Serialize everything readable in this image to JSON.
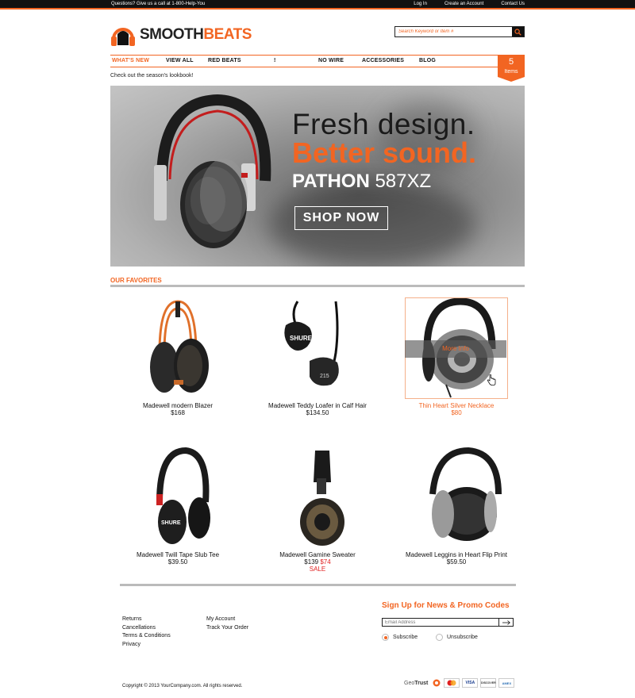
{
  "topbar": {
    "question": "Questions? Give us a call at 1-800-Help-You",
    "links": [
      "Log In",
      "Create an Account",
      "Contact Us"
    ]
  },
  "brand": {
    "part1": "SMOOTH",
    "part2": "BEATS",
    "accent": "#f26522"
  },
  "search": {
    "placeholder": "Search Keyword or Item #",
    "icon": "search-icon"
  },
  "nav": {
    "items": [
      "WHAT'S NEW",
      "VIEW ALL",
      "RED BEATS",
      "!",
      "NO WIRE",
      "ACCESSORIES",
      "BLOG"
    ],
    "active": "WHAT'S NEW"
  },
  "cart": {
    "count": "5",
    "label": "Items"
  },
  "lookbook": "Check out the season's lookbook!",
  "hero": {
    "line1": "Fresh design.",
    "line2": "Better sound.",
    "model_bold": "PATHON",
    "model_num": "587XZ",
    "button": "SHOP NOW"
  },
  "favorites": {
    "title": "OUR FAVORITES",
    "hover_label": "More Info",
    "products": [
      {
        "name": "Madewell modern Blazer",
        "price": "$168"
      },
      {
        "name": "Madewell Teddy Loafer in Calf Hair",
        "price": "$134.50"
      },
      {
        "name": "Thin Heart Silver Necklace",
        "price": "$80"
      },
      {
        "name": "Madewell Twill Tape Slub Tee",
        "price": "$39.50"
      },
      {
        "name": "Madewell Gamine Sweater",
        "old_price": "$139",
        "new_price": "$74",
        "sale": "SALE"
      },
      {
        "name": "Madewell Leggins in Heart Flip Print",
        "price": "$59.50"
      }
    ]
  },
  "footer": {
    "col1": [
      "Returns",
      "Cancellations",
      "Terms & Conditions",
      "Privacy"
    ],
    "col2": [
      "My Account",
      "Track Your Order"
    ],
    "signup_title": "Sign Up for News & Promo Codes",
    "email_placeholder": "Email Address",
    "subscribe": "Subscribe",
    "unsubscribe": "Unsubscribe",
    "copyright": "Copyright © 2013 YourCompany.com. All rights reserved.",
    "geotrust_a": "Geo",
    "geotrust_b": "Trust",
    "cards": [
      "VISA",
      "DISCOVER",
      "AMEX"
    ]
  }
}
